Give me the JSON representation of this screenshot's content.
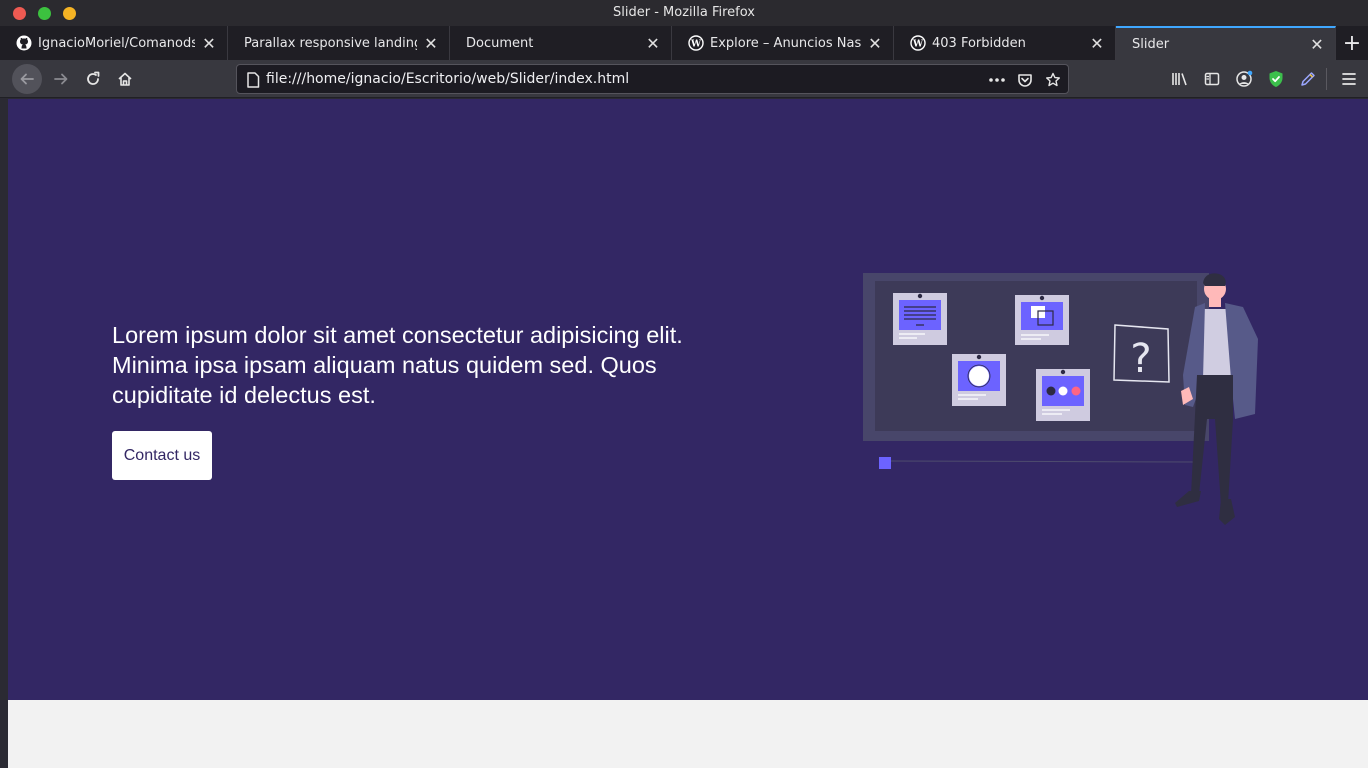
{
  "window": {
    "title": "Slider - Mozilla Firefox"
  },
  "tabs": [
    {
      "label": "IgnacioMoriel/Comanods",
      "icon": "github-icon"
    },
    {
      "label": "Parallax responsive landing p",
      "icon": "none"
    },
    {
      "label": "Document",
      "icon": "none"
    },
    {
      "label": "Explore – Anuncios Nash",
      "icon": "wordpress-icon"
    },
    {
      "label": "403 Forbidden",
      "icon": "wordpress-icon"
    },
    {
      "label": "Slider",
      "icon": "none",
      "active": true
    }
  ],
  "toolbar": {
    "url": "file:///home/ignacio/Escritorio/web/Slider/index.html"
  },
  "hero": {
    "text": "Lorem ipsum dolor sit amet consectetur adipisicing elit. Minima ipsa ipsam aliquam natus quidem sed. Quos cupiditate id delectus est.",
    "button_label": "Contact us",
    "illustration_mark": "?"
  },
  "colors": {
    "hero_bg": "#332764",
    "accent": "#6c63ff",
    "footer_bg": "#f2f2f2",
    "tab_active_border": "#3fa7ff"
  }
}
